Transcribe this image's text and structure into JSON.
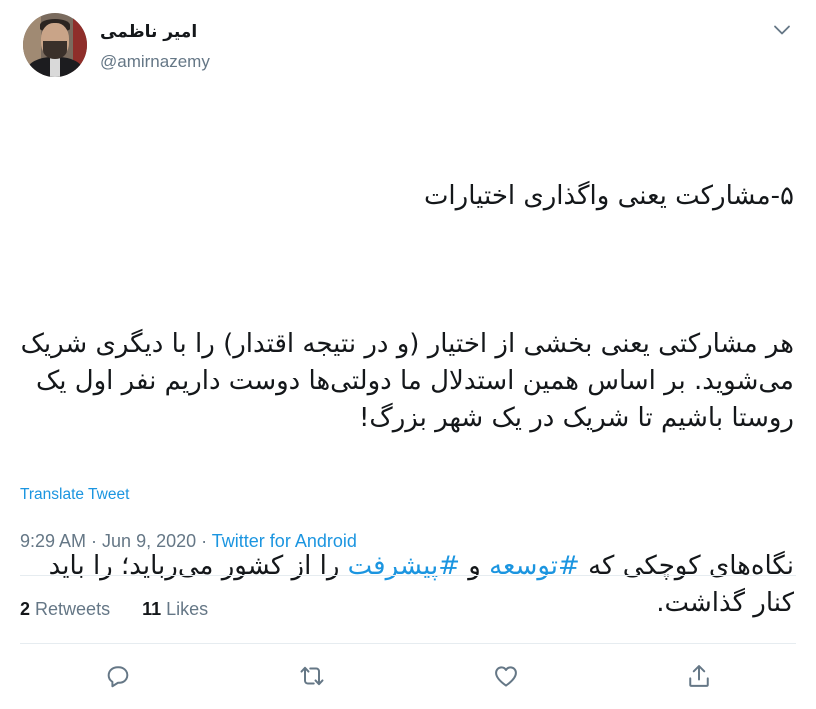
{
  "author": {
    "display_name": "امیر ناظمی",
    "handle": "@amirnazemy"
  },
  "tweet": {
    "paragraphs": [
      "۵-مشارکت یعنی واگذاری اختیارات",
      "هر مشارکتی یعنی بخشی از اختیار (و در نتیجه اقتدار) را با دیگری شریک می‌شوید. بر اساس همین استدلال ما دولتی‌ها دوست داریم نفر اول یک روستا باشیم تا شریک در یک شهر بزرگ!"
    ],
    "last_paragraph": {
      "part1": "نگاه‌های کوچکی که ",
      "hashtag1": "#توسعه",
      "part2": " و ",
      "hashtag2": "#پیشرفت",
      "part3": " را از کشور می‌رباید؛ را باید کنار گذاشت."
    }
  },
  "translate_label": "Translate Tweet",
  "meta": {
    "time": "9:29 AM",
    "separator1": " · ",
    "date": "Jun 9, 2020",
    "separator2": " · ",
    "source": "Twitter for Android"
  },
  "stats": {
    "retweets_count": "2",
    "retweets_label": "Retweets",
    "likes_count": "11",
    "likes_label": "Likes"
  },
  "icons": {
    "more": "chevron-down-icon",
    "reply": "reply-icon",
    "retweet": "retweet-icon",
    "like": "heart-icon",
    "share": "share-icon"
  },
  "colors": {
    "link": "#1b95e0",
    "secondary": "#657786",
    "text": "#14171a",
    "divider": "#e6ecf0"
  }
}
